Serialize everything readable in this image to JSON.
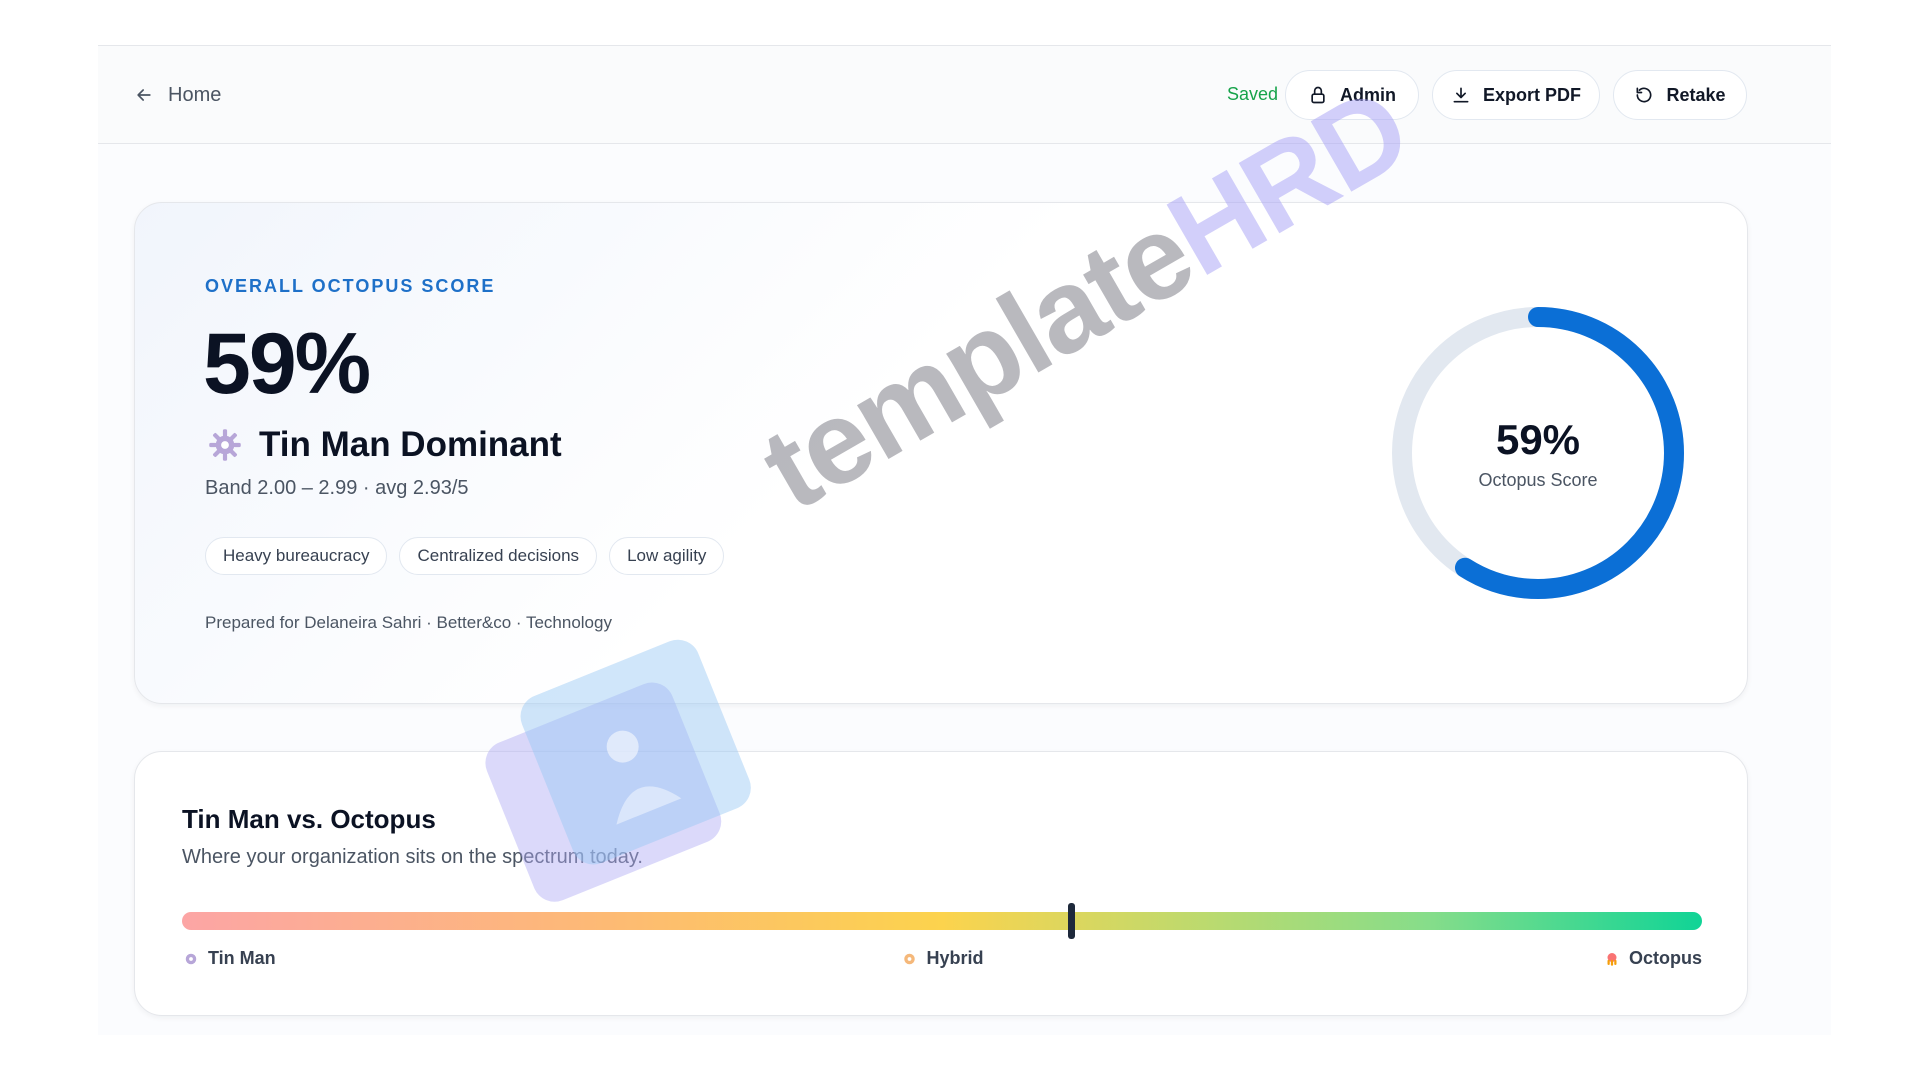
{
  "topbar": {
    "home_label": "Home",
    "saved_label": "Saved",
    "admin_label": "Admin",
    "export_label": "Export PDF",
    "retake_label": "Retake"
  },
  "score": {
    "eyebrow": "OVERALL OCTOPUS SCORE",
    "value_text": "59%",
    "value": 0.59,
    "type_title": "Tin Man Dominant",
    "band_text": "Band 2.00 – 2.99 · avg 2.93/5",
    "tags": [
      "Heavy bureaucracy",
      "Centralized decisions",
      "Low agility"
    ],
    "prepared_text": "Prepared for Delaneira Sahri · Better&co · Technology",
    "ring_value": "59%",
    "ring_label": "Octopus Score",
    "ring_color": "#0b6fd6",
    "ring_track_color": "#e2e8f0"
  },
  "spectrum": {
    "title": "Tin Man vs. Octopus",
    "subtitle": "Where your organization sits on the spectrum today.",
    "position": 0.585,
    "labels": {
      "left": "Tin Man",
      "middle": "Hybrid",
      "right": "Octopus"
    },
    "icons": {
      "left": "gear-icon",
      "middle": "hybrid-icon",
      "right": "octopus-icon"
    }
  },
  "watermark": {
    "part_a": "template",
    "part_b": "HRD"
  }
}
